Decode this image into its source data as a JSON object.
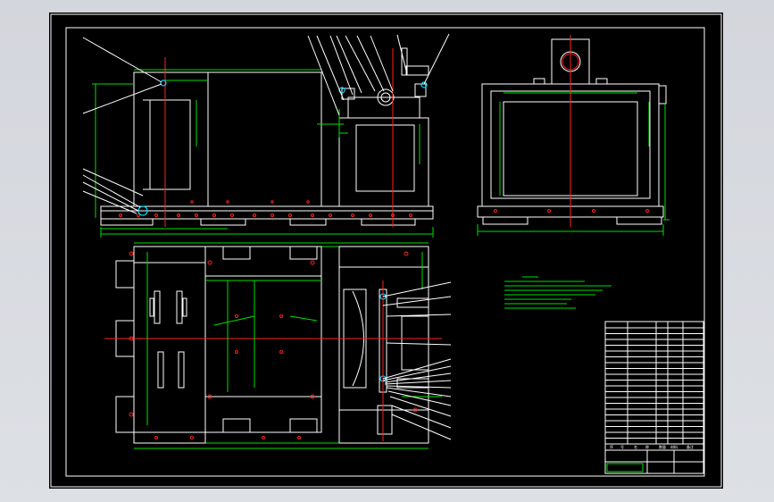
{
  "drawing": {
    "title_block_labels": [
      "序",
      "号",
      "名",
      "称",
      "数量",
      "材料",
      "备注"
    ]
  }
}
